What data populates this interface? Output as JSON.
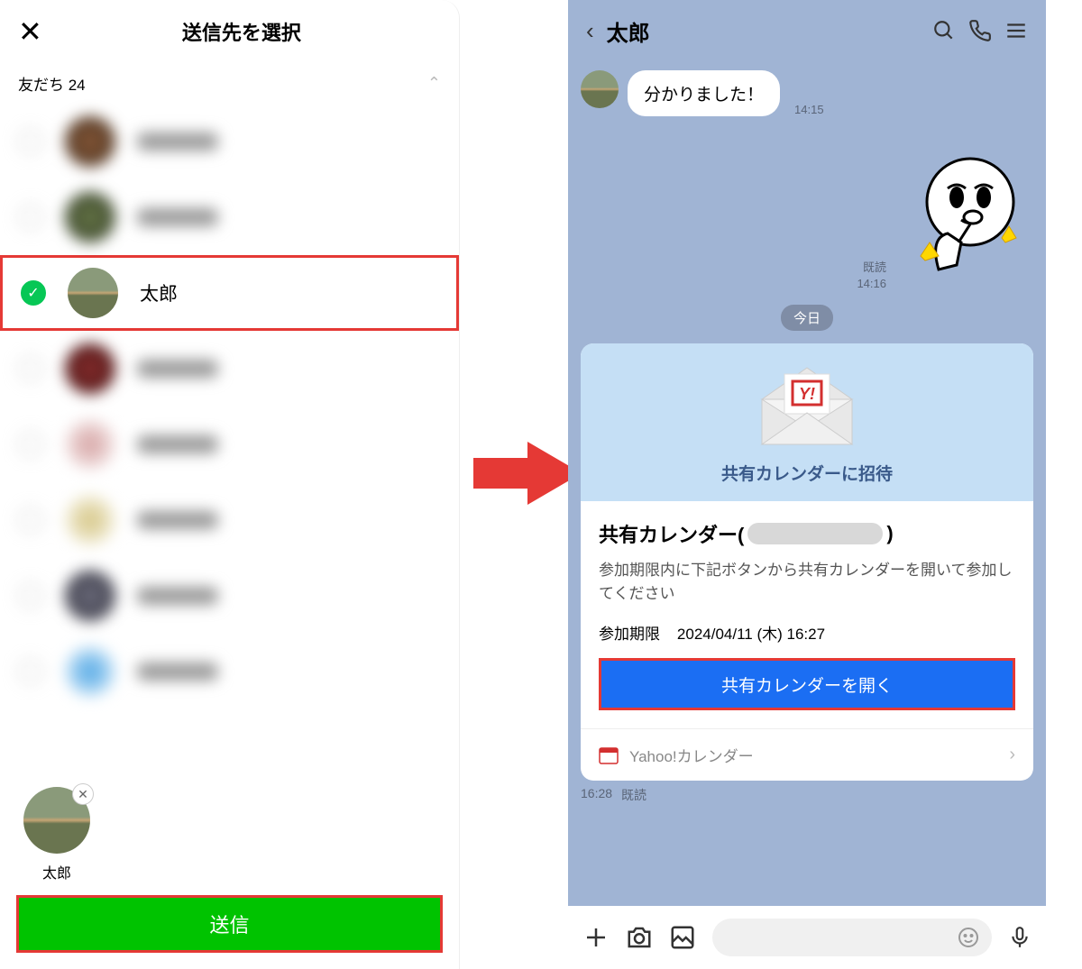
{
  "left": {
    "title": "送信先を選択",
    "friends_label": "友だち 24",
    "items": [
      {
        "name": "",
        "selected": false
      },
      {
        "name": "",
        "selected": false
      },
      {
        "name": "太郎",
        "selected": true
      },
      {
        "name": "",
        "selected": false
      },
      {
        "name": "",
        "selected": false
      },
      {
        "name": "",
        "selected": false
      },
      {
        "name": "",
        "selected": false
      },
      {
        "name": "",
        "selected": false
      }
    ],
    "selected_chip_name": "太郎",
    "send_button": "送信"
  },
  "right": {
    "chat_title": "太郎",
    "incoming_msg": "分かりました！",
    "incoming_time": "14:15",
    "sticker_read": "既読",
    "sticker_time": "14:16",
    "date_divider": "今日",
    "card": {
      "header": "共有カレンダーに招待",
      "title_prefix": "共有カレンダー(",
      "title_suffix": ")",
      "desc": "参加期限内に下記ボタンから共有カレンダーを開いて参加してください",
      "deadline_label": "参加期限",
      "deadline_value": "2024/04/11 (木) 16:27",
      "open_button": "共有カレンダーを開く",
      "footer": "Yahoo!カレンダー"
    },
    "card_time": "16:28",
    "card_read": "既読"
  }
}
